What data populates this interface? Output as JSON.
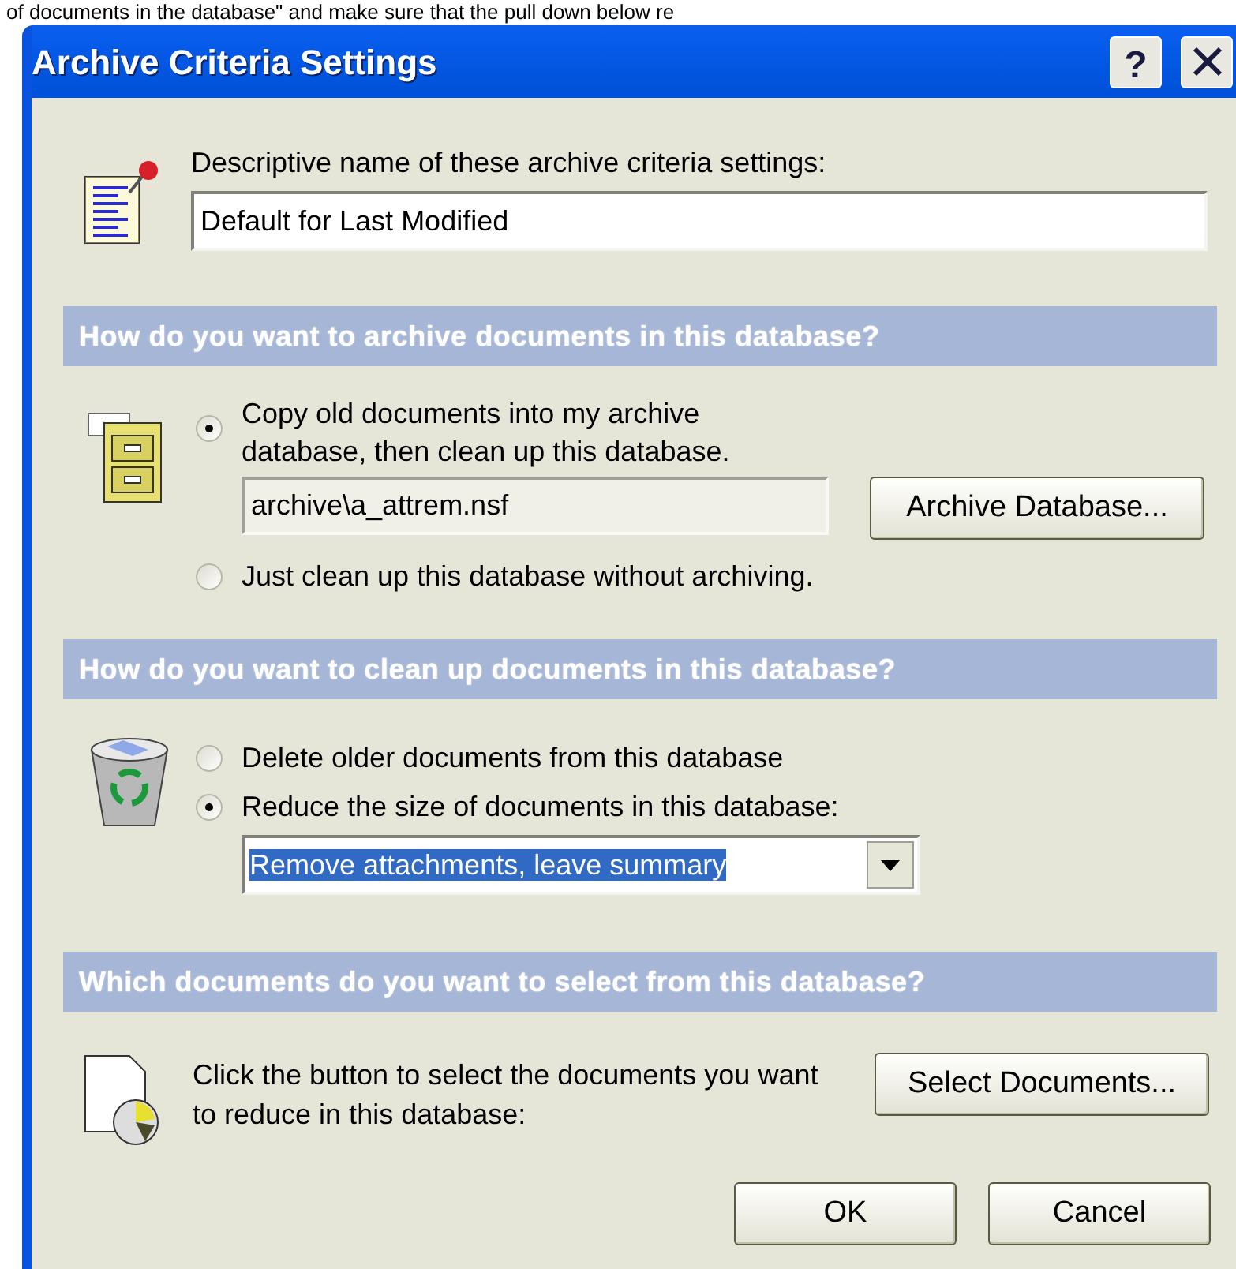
{
  "page_text": "of documents in the database\" and make sure that the pull down below re",
  "window": {
    "title": "Archive Criteria Settings",
    "help_button": "?"
  },
  "name_section": {
    "label": "Descriptive name of these archive criteria settings:",
    "value": "Default for Last Modified"
  },
  "archive_section": {
    "heading": "How do you want to archive documents in this database?",
    "options": [
      {
        "label": "Copy old documents into my archive database, then clean up this database.",
        "selected": true
      },
      {
        "label": "Just clean up this database without archiving.",
        "selected": false
      }
    ],
    "path_field": {
      "value": "archive\\a_attrem.nsf"
    },
    "button": "Archive Database..."
  },
  "cleanup_section": {
    "heading": "How do you want to clean up documents in this database?",
    "options": [
      {
        "label": "Delete older documents from this database",
        "selected": false
      },
      {
        "label": "Reduce the size of documents in this database:",
        "selected": true
      }
    ],
    "dropdown": {
      "value": "Remove attachments, leave summary",
      "highlighted": true
    }
  },
  "select_section": {
    "heading": "Which documents do you want to select from this database?",
    "description": "Click the button to select the documents you want to reduce in this database:",
    "button": "Select Documents..."
  },
  "buttons": [
    "OK",
    "Cancel"
  ]
}
